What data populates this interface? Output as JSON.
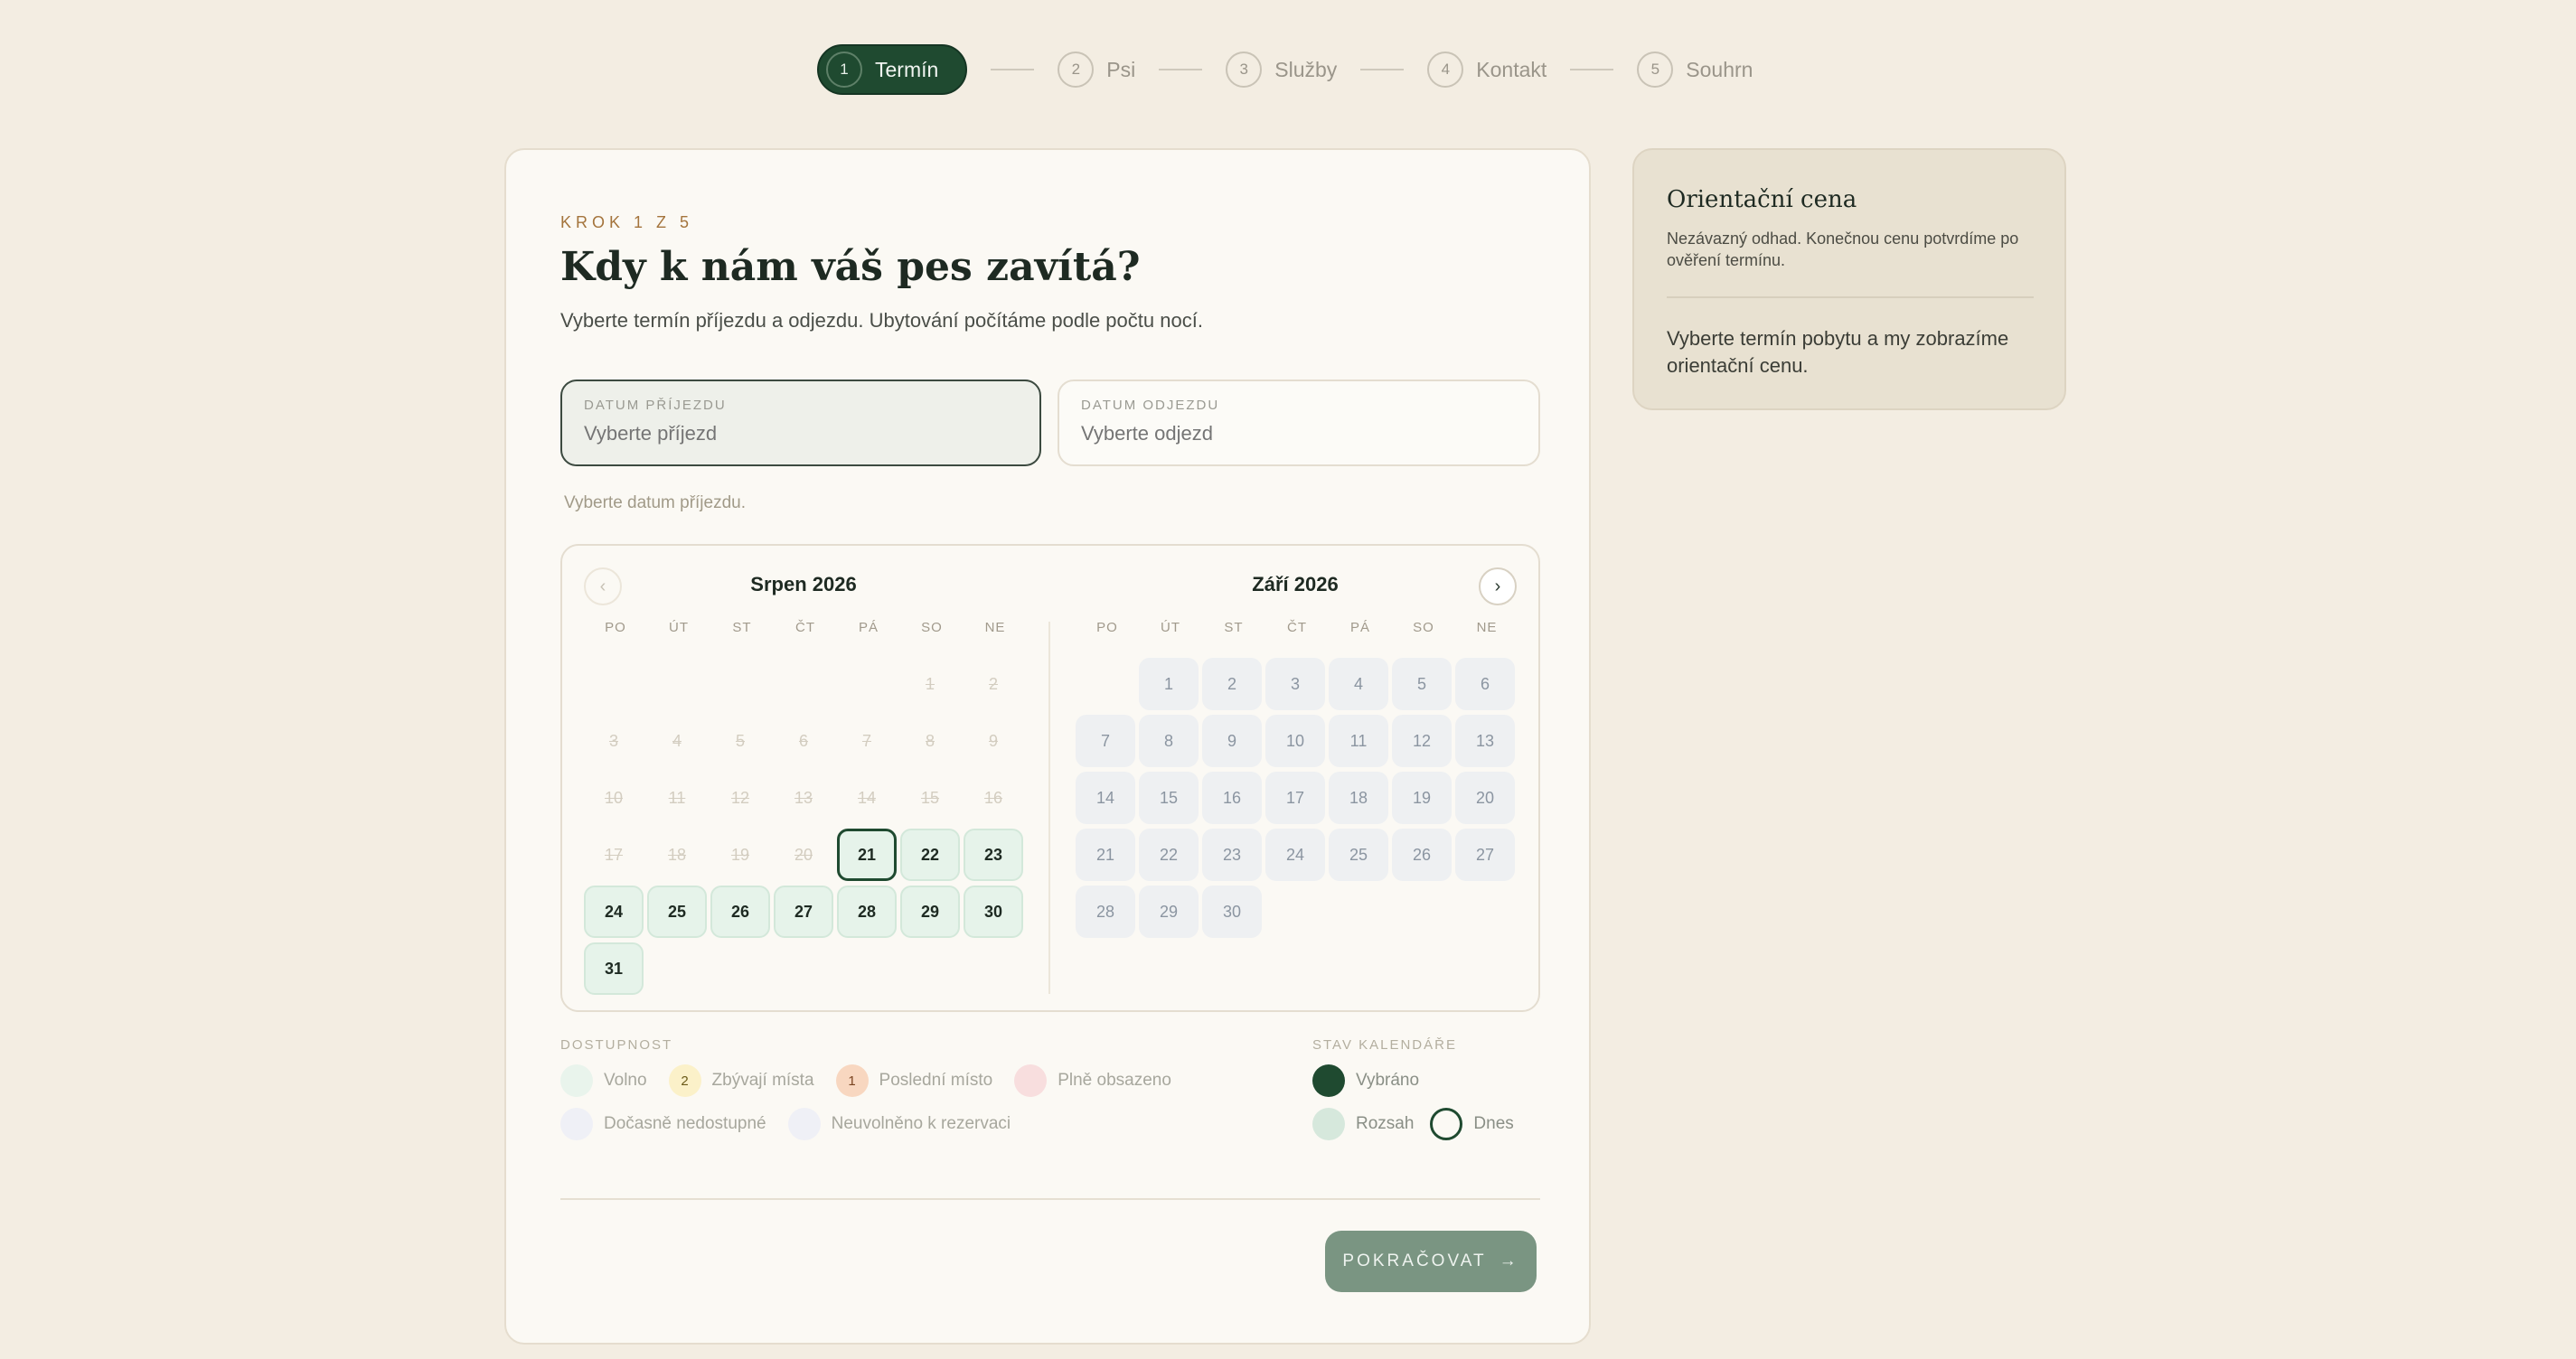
{
  "stepper": {
    "steps": [
      {
        "num": "1",
        "label": "Termín"
      },
      {
        "num": "2",
        "label": "Psi"
      },
      {
        "num": "3",
        "label": "Služby"
      },
      {
        "num": "4",
        "label": "Kontakt"
      },
      {
        "num": "5",
        "label": "Souhrn"
      }
    ],
    "active_index": 0
  },
  "card": {
    "kicker": "KROK 1 Z 5",
    "title": "Kdy k nám váš pes zavítá?",
    "subtitle": "Vyberte termín příjezdu a odjezdu. Ubytování počítáme podle počtu nocí.",
    "arrival": {
      "label": "DATUM PŘÍJEZDU",
      "placeholder": "Vyberte příjezd"
    },
    "departure": {
      "label": "DATUM ODJEZDU",
      "placeholder": "Vyberte odjezd"
    },
    "hint": "Vyberte datum příjezdu."
  },
  "calendar": {
    "weekdays": [
      "PO",
      "ÚT",
      "ST",
      "ČT",
      "PÁ",
      "SO",
      "NE"
    ],
    "prev_icon": "‹",
    "next_icon": "›",
    "months": [
      {
        "title": "Srpen 2026",
        "offset": 5,
        "days": 31,
        "past_until": 20,
        "today": 21,
        "state": "free"
      },
      {
        "title": "Září 2026",
        "offset": 1,
        "days": 30,
        "past_until": 0,
        "today": 0,
        "state": "closed"
      }
    ]
  },
  "legend": {
    "availability_title": "DOSTUPNOST",
    "availability": [
      {
        "key": "free",
        "label": "Volno",
        "badge": ""
      },
      {
        "key": "few",
        "label": "Zbývají místa",
        "badge": "2"
      },
      {
        "key": "last",
        "label": "Poslední místo",
        "badge": "1"
      },
      {
        "key": "full",
        "label": "Plně obsazeno",
        "badge": ""
      },
      {
        "key": "temp",
        "label": "Dočasně nedostupné",
        "badge": ""
      },
      {
        "key": "notrel",
        "label": "Neuvolněno k rezervaci",
        "badge": ""
      }
    ],
    "status_title": "STAV KALENDÁŘE",
    "status": [
      {
        "key": "sel",
        "label": "Vybráno"
      },
      {
        "key": "range",
        "label": "Rozsah"
      },
      {
        "key": "today",
        "label": "Dnes"
      }
    ]
  },
  "footer": {
    "continue_label": "POKRAČOVAT",
    "continue_icon": "→"
  },
  "side": {
    "title": "Orientační cena",
    "note": "Nezávazný odhad. Konečnou cenu potvrdíme po ověření termínu.",
    "message": "Vyberte termín pobytu a my zobrazíme orientační cenu."
  },
  "colors": {
    "primary": "#1f4a30",
    "accent": "#a4743c",
    "background": "#f3ede2"
  }
}
